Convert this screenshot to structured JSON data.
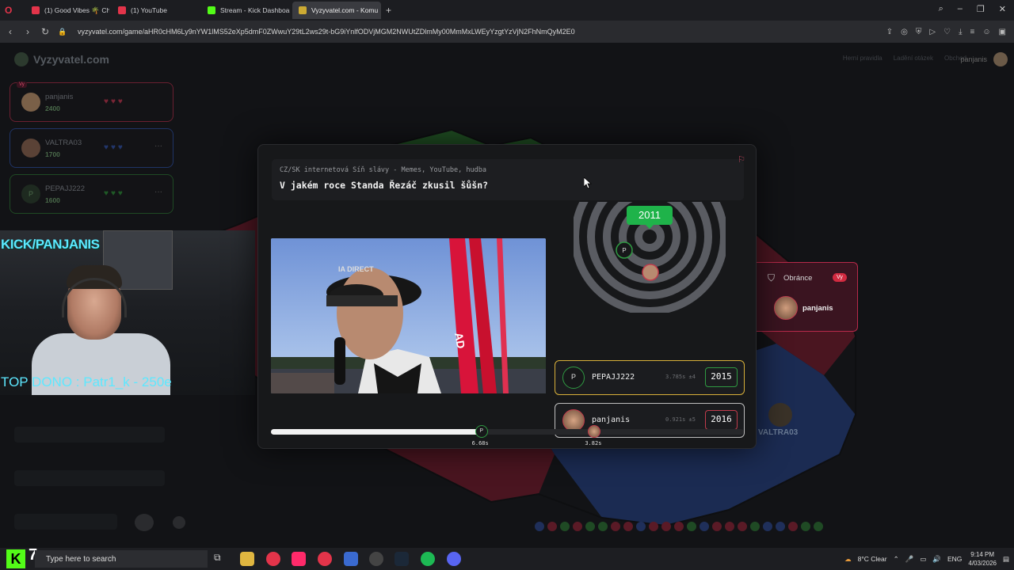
{
  "browser": {
    "tabs": [
      {
        "label": "(1) Good Vibes 🌴 Chill H",
        "color": "#e3344a"
      },
      {
        "label": "(1) YouTube",
        "color": "#e3344a"
      },
      {
        "label": "Stream - Kick Dashboard",
        "color": "#53fc18"
      },
      {
        "label": "Vyzyvatel.com - Komu",
        "color": "#ccaa33"
      }
    ],
    "new_tab": "+",
    "url": "vyzyvatel.com/game/aHR0cHM6Ly9nYW1lMS52eXp5dmF0ZWwuY29tL2ws29t-bG9iYnlfODVjMGM2NWUtZDlmMy00MmMxLWEyYzgtYzVjN2FhNmQyM2E0"
  },
  "site": {
    "logo": "Vyzyvatel.com",
    "nav": [
      "Herní pravidla",
      "Ladění otázek",
      "Obchod"
    ],
    "user": "panjanis"
  },
  "players": [
    {
      "name": "panjanis",
      "score": "2400",
      "badge": "Vy",
      "color": "#c0304a",
      "hearts": "♥♥♥",
      "heart_color": "#c0304a"
    },
    {
      "name": "VALTRA03",
      "score": "1700",
      "color": "#2f4fa0",
      "hearts": "♥♥♥",
      "heart_color": "#2f4fa0",
      "more": "···"
    },
    {
      "name": "PEPAJJ222",
      "initial": "P",
      "score": "1600",
      "color": "#2f8a3a",
      "hearts": "♥♥♥",
      "heart_color": "#2f8a3a",
      "more": "···"
    }
  ],
  "stream": {
    "channel": "KICK/PANJANIS",
    "top_donor": "TOP DONO : Patr1_k - 250e"
  },
  "question": {
    "category": "CZ/SK internetová Síň slávy - Memes, YouTube, hudba",
    "text": "V jakém roce Standa Řezáč zkusil šůšn?",
    "correct_year": "2011"
  },
  "answers": [
    {
      "name": "PEPAJJ222",
      "initial": "P",
      "time": "3.785s",
      "diff": "±4",
      "year": "2015",
      "border": "#d8b03a"
    },
    {
      "name": "panjanis",
      "time": "0.921s",
      "diff": "±5",
      "year": "2016",
      "border": "#c9c9c9"
    }
  ],
  "timeline": {
    "fill_fraction": 0.445,
    "markers": [
      {
        "initial": "P",
        "label": "6.68s",
        "pos": 0.445
      },
      {
        "label": "3.82s",
        "pos": 0.684
      }
    ]
  },
  "defenders": {
    "label": "Obránce",
    "badge": "Vy",
    "name": "panjanis"
  },
  "map_label": "VALTRA03",
  "taskbar": {
    "search_placeholder": "Type here to search",
    "weather": "8°C  Clear",
    "lang": "ENG",
    "time": "9:14 PM",
    "date": "4/03/2026",
    "kick_count": "7"
  }
}
